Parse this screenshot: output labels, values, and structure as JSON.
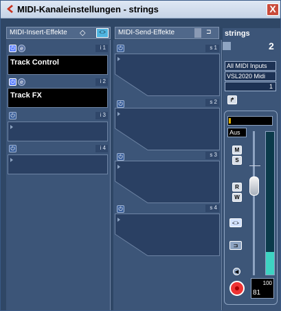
{
  "window": {
    "title": "MIDI-Kanaleinstellungen - strings",
    "close_label": "X"
  },
  "insert_section": {
    "header": "MIDI-Insert-Effekte",
    "slots": [
      {
        "num": "i 1",
        "name": "Track Control",
        "power_on": true
      },
      {
        "num": "i 2",
        "name": "Track FX",
        "power_on": true
      },
      {
        "num": "i 3",
        "name": "",
        "power_on": false
      },
      {
        "num": "i 4",
        "name": "",
        "power_on": false
      }
    ]
  },
  "send_section": {
    "header": "MIDI-Send-Effekte",
    "slots": [
      {
        "num": "s 1"
      },
      {
        "num": "s 2"
      },
      {
        "num": "s 3"
      },
      {
        "num": "s 4"
      }
    ]
  },
  "channel": {
    "name": "strings",
    "number": "2",
    "input": "All MIDI Inputs",
    "output": "VSL2020 Midi",
    "midi_channel": "1",
    "automation": "Aus",
    "mute_label": "M",
    "solo_label": "S",
    "read_label": "R",
    "write_label": "W",
    "fader_max": "100",
    "fader_value": "81",
    "meter_level": 0.16
  },
  "colors": {
    "window_bg": "#2f4766",
    "slot_black": "#000000",
    "meter": "#3ed3c2"
  },
  "icons": [
    "midi-logo-icon",
    "close-icon",
    "power-icon",
    "edit-icon",
    "expand-triangle-icon",
    "record-icon"
  ]
}
